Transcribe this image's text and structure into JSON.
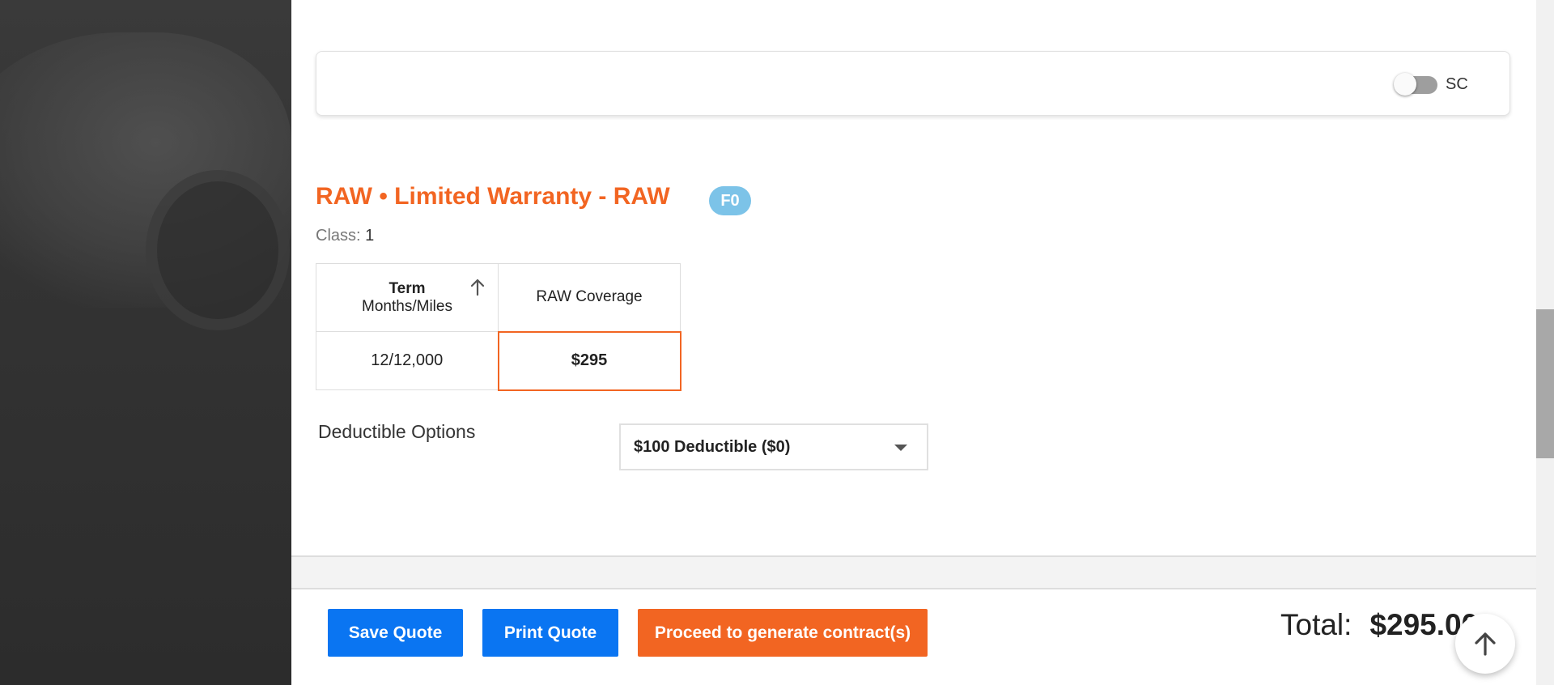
{
  "coverage_card": {
    "toggle_label": "SC",
    "toggle_on": false
  },
  "product": {
    "title": "RAW • Limited Warranty - RAW",
    "badge": "F0",
    "class_label": "Class:",
    "class_value": "1"
  },
  "rates_table": {
    "headers": {
      "term_title": "Term",
      "term_sub": "Months/Miles",
      "coverage": "RAW Coverage"
    },
    "rows": [
      {
        "term": "12/12,000",
        "price": "$295",
        "selected": true
      }
    ]
  },
  "deductible": {
    "label": "Deductible Options",
    "selected": "$100 Deductible ($0)"
  },
  "footer": {
    "save_label": "Save Quote",
    "print_label": "Print Quote",
    "proceed_label": "Proceed to generate contract(s)",
    "total_label": "Total:",
    "total_value": "$295.00"
  },
  "colors": {
    "accent_orange": "#f26522",
    "primary_blue": "#0a75f2",
    "badge_blue": "#7cc3e8"
  },
  "icons": [
    "sort-arrow-up-icon",
    "caret-down-icon",
    "scroll-to-top-icon"
  ]
}
